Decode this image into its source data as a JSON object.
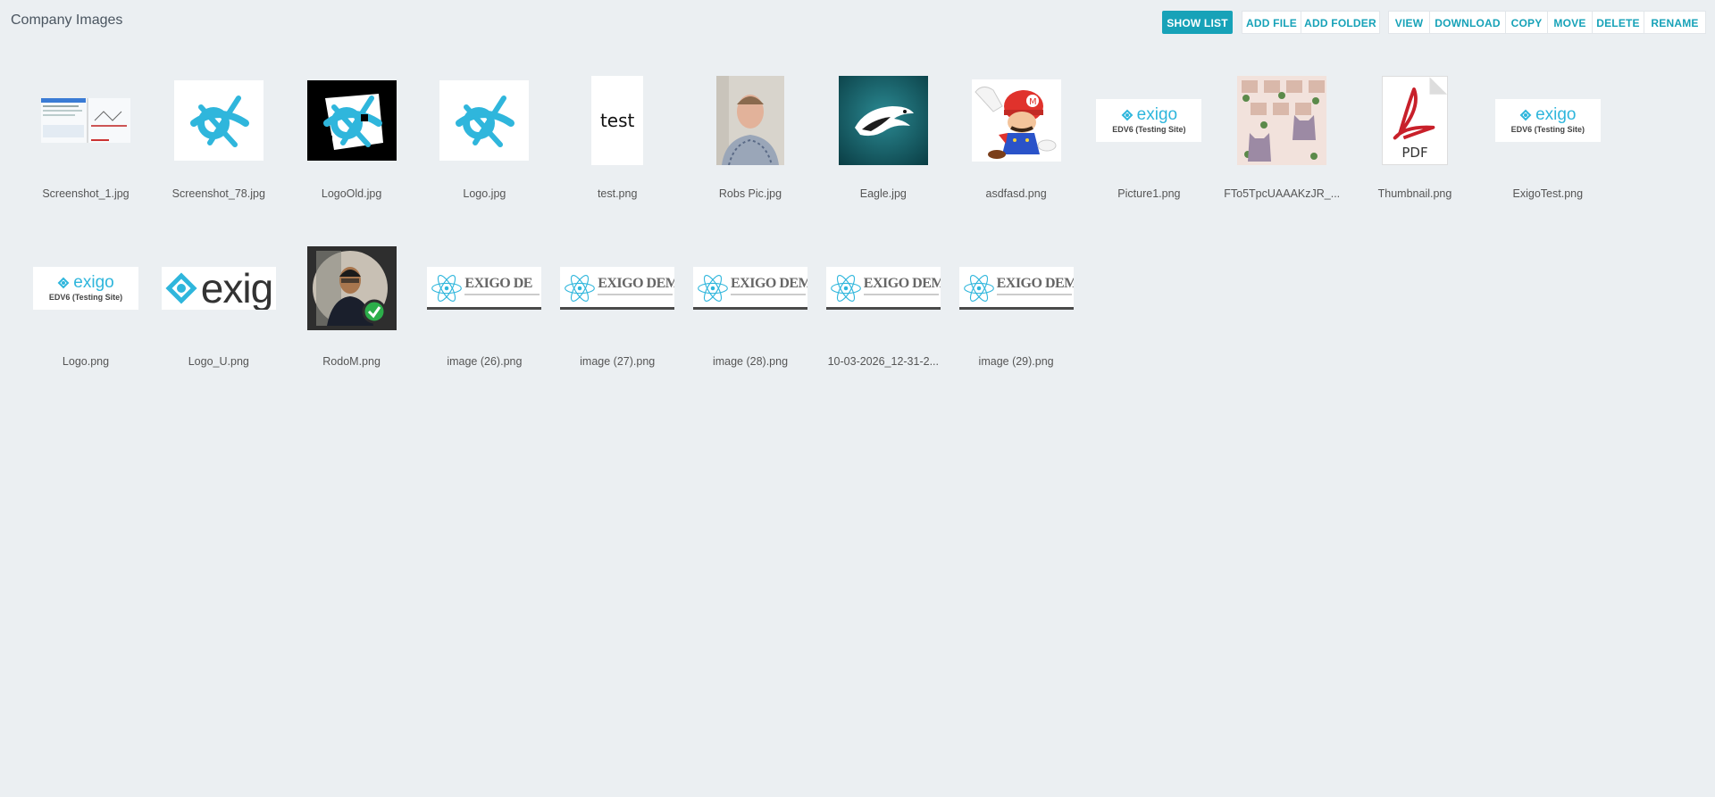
{
  "page": {
    "title": "Company Images"
  },
  "toolbar": {
    "show_list": "SHOW LIST",
    "add_file": "ADD FILE",
    "add_folder": "ADD FOLDER",
    "view": "VIEW",
    "download": "DOWNLOAD",
    "copy": "COPY",
    "move": "MOVE",
    "delete": "DELETE",
    "rename": "RENAME"
  },
  "colors": {
    "accent": "#17a2b8",
    "background": "#ebeff2"
  },
  "files": [
    {
      "name": "Screenshot_1.jpg",
      "thumb": "screenshot-thumbnail"
    },
    {
      "name": "Screenshot_78.jpg",
      "thumb": "star-logo-thumbnail"
    },
    {
      "name": "LogoOld.jpg",
      "thumb": "star-logo-black-thumbnail"
    },
    {
      "name": "Logo.jpg",
      "thumb": "star-logo-thumbnail"
    },
    {
      "name": "test.png",
      "thumb": "text-thumbnail",
      "thumb_text": "test"
    },
    {
      "name": "Robs Pic.jpg",
      "thumb": "portrait-thumbnail"
    },
    {
      "name": "Eagle.jpg",
      "thumb": "eagle-logo-thumbnail"
    },
    {
      "name": "asdfasd.png",
      "thumb": "character-thumbnail"
    },
    {
      "name": "Picture1.png",
      "thumb": "exigo-logo-thumbnail",
      "logo_word": "exigo",
      "logo_sub": "EDV6 (Testing Site)"
    },
    {
      "name": "FTo5TpcUAAAKzJR_...",
      "thumb": "cats-thumbnail"
    },
    {
      "name": "Thumbnail.png",
      "thumb": "pdf-icon-thumbnail",
      "thumb_text": "PDF"
    },
    {
      "name": "ExigoTest.png",
      "thumb": "exigo-logo-thumbnail",
      "logo_word": "exigo",
      "logo_sub": "EDV6 (Testing Site)"
    },
    {
      "name": "Logo.png",
      "thumb": "exigo-logo-thumbnail",
      "logo_word": "exigo",
      "logo_sub": "EDV6 (Testing Site)"
    },
    {
      "name": "Logo_U.png",
      "thumb": "exigo-large-thumbnail",
      "logo_word": "exig"
    },
    {
      "name": "RodoM.png",
      "thumb": "avatar-thumbnail"
    },
    {
      "name": "image (26).png",
      "thumb": "banner-thumbnail",
      "logo_word": "EXIGO DE"
    },
    {
      "name": "image (27).png",
      "thumb": "banner-thumbnail",
      "logo_word": "EXIGO DEMOVE"
    },
    {
      "name": "image (28).png",
      "thumb": "banner-thumbnail",
      "logo_word": "EXIGO DEMOVE"
    },
    {
      "name": "10-03-2026_12-31-2...",
      "thumb": "banner-thumbnail",
      "logo_word": "EXIGO DEMO"
    },
    {
      "name": "image (29).png",
      "thumb": "banner-thumbnail",
      "logo_word": "EXIGO DEMO"
    }
  ]
}
